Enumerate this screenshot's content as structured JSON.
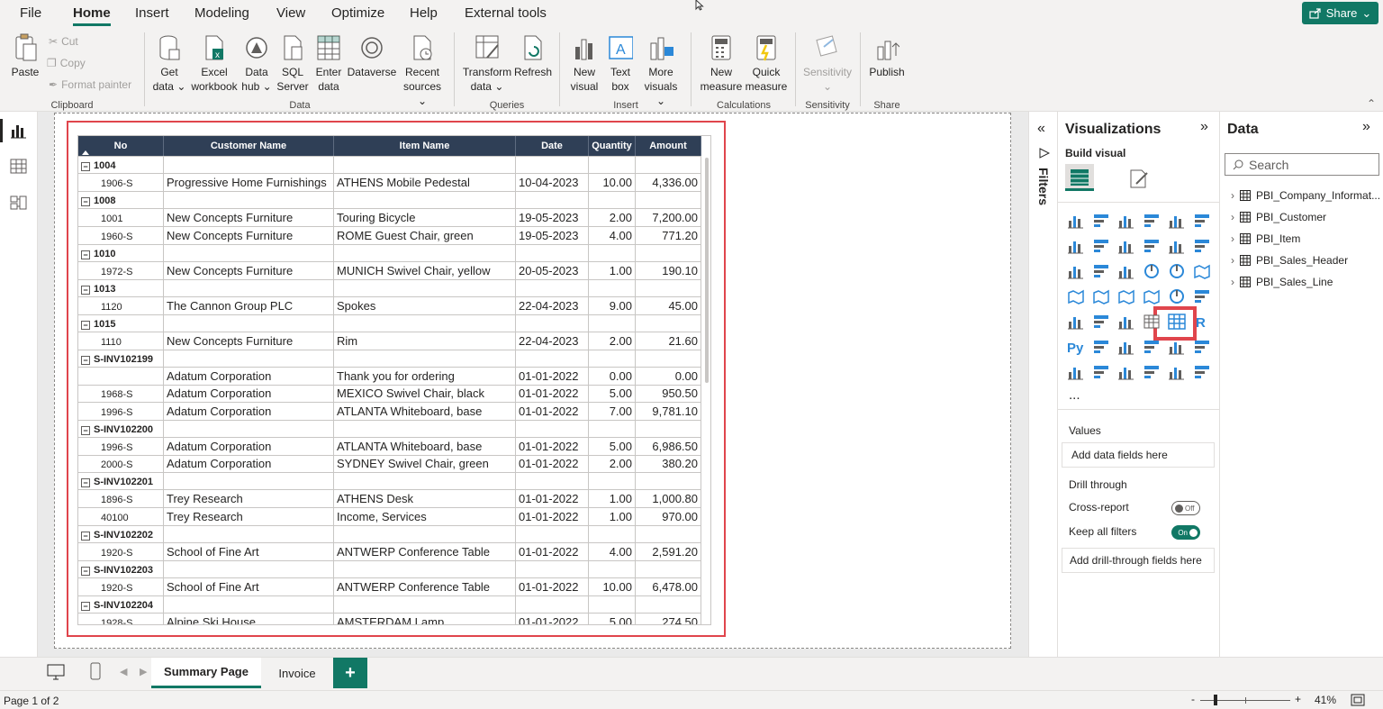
{
  "menu": {
    "tabs": [
      "File",
      "Home",
      "Insert",
      "Modeling",
      "View",
      "Optimize",
      "Help",
      "External tools"
    ],
    "active": "Home",
    "share_label": "Share"
  },
  "ribbon": {
    "clipboard": {
      "paste": "Paste",
      "cut": "Cut",
      "copy": "Copy",
      "format_painter": "Format painter",
      "label": "Clipboard"
    },
    "data": {
      "get_data": [
        "Get",
        "data"
      ],
      "excel": [
        "Excel",
        "workbook"
      ],
      "data_hub": [
        "Data",
        "hub"
      ],
      "sql": [
        "SQL",
        "Server"
      ],
      "enter": [
        "Enter",
        "data"
      ],
      "dataverse": "Dataverse",
      "recent": [
        "Recent",
        "sources"
      ],
      "label": "Data"
    },
    "queries": {
      "transform": [
        "Transform",
        "data"
      ],
      "refresh": "Refresh",
      "label": "Queries"
    },
    "insert": {
      "new_visual": [
        "New",
        "visual"
      ],
      "text_box": [
        "Text",
        "box"
      ],
      "more_visuals": [
        "More",
        "visuals"
      ],
      "label": "Insert"
    },
    "calculations": {
      "new_measure": [
        "New",
        "measure"
      ],
      "quick_measure": [
        "Quick",
        "measure"
      ],
      "label": "Calculations"
    },
    "sensitivity": {
      "btn": "Sensitivity",
      "label": "Sensitivity"
    },
    "share": {
      "publish": "Publish",
      "label": "Share"
    }
  },
  "table": {
    "headers": [
      "No",
      "Customer Name",
      "Item Name",
      "Date",
      "Quantity",
      "Amount"
    ],
    "rows": [
      {
        "type": "group",
        "no": "1004"
      },
      {
        "type": "line",
        "no": "1906-S",
        "customer": "Progressive Home Furnishings",
        "item": "ATHENS Mobile Pedestal",
        "date": "10-04-2023",
        "qty": "10.00",
        "amount": "4,336.00"
      },
      {
        "type": "group",
        "no": "1008"
      },
      {
        "type": "line",
        "no": "1001",
        "customer": "New Concepts Furniture",
        "item": "Touring Bicycle",
        "date": "19-05-2023",
        "qty": "2.00",
        "amount": "7,200.00"
      },
      {
        "type": "line",
        "no": "1960-S",
        "customer": "New Concepts Furniture",
        "item": "ROME Guest Chair, green",
        "date": "19-05-2023",
        "qty": "4.00",
        "amount": "771.20"
      },
      {
        "type": "group",
        "no": "1010"
      },
      {
        "type": "line",
        "no": "1972-S",
        "customer": "New Concepts Furniture",
        "item": "MUNICH Swivel Chair, yellow",
        "date": "20-05-2023",
        "qty": "1.00",
        "amount": "190.10"
      },
      {
        "type": "group",
        "no": "1013"
      },
      {
        "type": "line",
        "no": "1120",
        "customer": "The Cannon Group PLC",
        "item": "Spokes",
        "date": "22-04-2023",
        "qty": "9.00",
        "amount": "45.00"
      },
      {
        "type": "group",
        "no": "1015"
      },
      {
        "type": "line",
        "no": "1110",
        "customer": "New Concepts Furniture",
        "item": "Rim",
        "date": "22-04-2023",
        "qty": "2.00",
        "amount": "21.60"
      },
      {
        "type": "group",
        "no": "S-INV102199"
      },
      {
        "type": "line",
        "no": "",
        "customer": "Adatum Corporation",
        "item": "Thank you for ordering",
        "date": "01-01-2022",
        "qty": "0.00",
        "amount": "0.00"
      },
      {
        "type": "line",
        "no": "1968-S",
        "customer": "Adatum Corporation",
        "item": "MEXICO Swivel Chair, black",
        "date": "01-01-2022",
        "qty": "5.00",
        "amount": "950.50"
      },
      {
        "type": "line",
        "no": "1996-S",
        "customer": "Adatum Corporation",
        "item": "ATLANTA Whiteboard, base",
        "date": "01-01-2022",
        "qty": "7.00",
        "amount": "9,781.10"
      },
      {
        "type": "group",
        "no": "S-INV102200"
      },
      {
        "type": "line",
        "no": "1996-S",
        "customer": "Adatum Corporation",
        "item": "ATLANTA Whiteboard, base",
        "date": "01-01-2022",
        "qty": "5.00",
        "amount": "6,986.50"
      },
      {
        "type": "line",
        "no": "2000-S",
        "customer": "Adatum Corporation",
        "item": "SYDNEY Swivel Chair, green",
        "date": "01-01-2022",
        "qty": "2.00",
        "amount": "380.20"
      },
      {
        "type": "group",
        "no": "S-INV102201"
      },
      {
        "type": "line",
        "no": "1896-S",
        "customer": "Trey Research",
        "item": "ATHENS Desk",
        "date": "01-01-2022",
        "qty": "1.00",
        "amount": "1,000.80"
      },
      {
        "type": "line",
        "no": "40100",
        "customer": "Trey Research",
        "item": "Income, Services",
        "date": "01-01-2022",
        "qty": "1.00",
        "amount": "970.00"
      },
      {
        "type": "group",
        "no": "S-INV102202"
      },
      {
        "type": "line",
        "no": "1920-S",
        "customer": "School of Fine Art",
        "item": "ANTWERP Conference Table",
        "date": "01-01-2022",
        "qty": "4.00",
        "amount": "2,591.20"
      },
      {
        "type": "group",
        "no": "S-INV102203"
      },
      {
        "type": "line",
        "no": "1920-S",
        "customer": "School of Fine Art",
        "item": "ANTWERP Conference Table",
        "date": "01-01-2022",
        "qty": "10.00",
        "amount": "6,478.00"
      },
      {
        "type": "group",
        "no": "S-INV102204"
      },
      {
        "type": "line",
        "no": "1928-S",
        "customer": "Alpine Ski House",
        "item": "AMSTERDAM Lamp",
        "date": "01-01-2022",
        "qty": "5.00",
        "amount": "274.50"
      }
    ]
  },
  "filters": {
    "label": "Filters"
  },
  "visualizations": {
    "title": "Visualizations",
    "build_visual": "Build visual",
    "more": "...",
    "values": "Values",
    "add_data": "Add data fields here",
    "drill_through": "Drill through",
    "cross_report": "Cross-report",
    "cross_report_state": "Off",
    "keep_filters": "Keep all filters",
    "keep_filters_state": "On",
    "add_drill": "Add drill-through fields here"
  },
  "data_pane": {
    "title": "Data",
    "search_placeholder": "Search",
    "tables": [
      "PBI_Company_Informat...",
      "PBI_Customer",
      "PBI_Item",
      "PBI_Sales_Header",
      "PBI_Sales_Line"
    ]
  },
  "pages": {
    "tabs": [
      "Summary Page",
      "Invoice"
    ],
    "active": "Summary Page",
    "add": "+"
  },
  "status": {
    "page": "Page 1 of 2",
    "zoom": "41%",
    "zoom_minus": "-",
    "zoom_plus": "+"
  },
  "colors": {
    "accent": "#117865",
    "header": "#2f3f56",
    "highlight": "#e0454c"
  }
}
